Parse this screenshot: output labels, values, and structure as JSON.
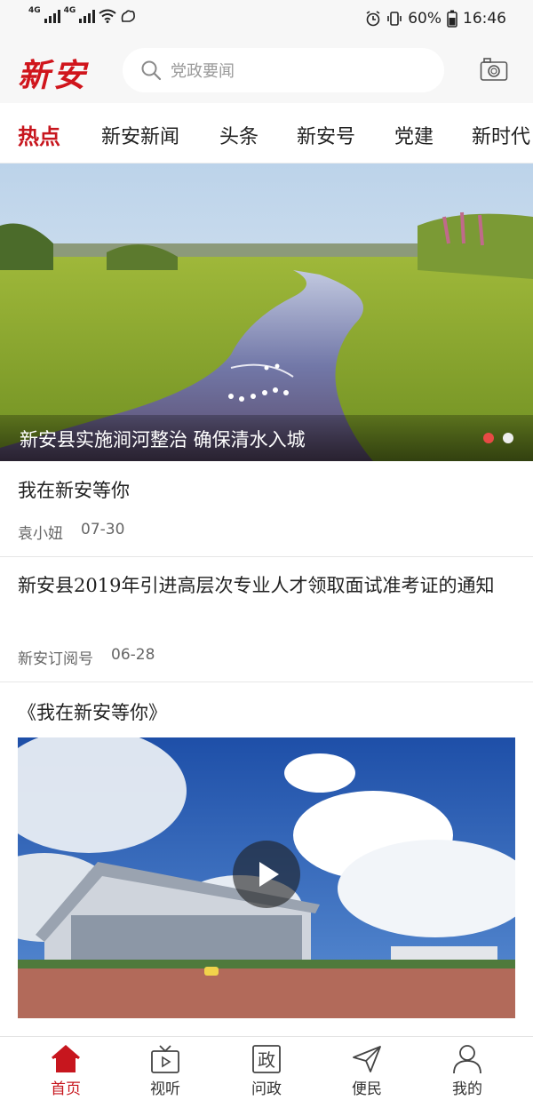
{
  "status_bar": {
    "network_1": "4G",
    "network_2": "4G",
    "battery": "60%",
    "time": "16:46",
    "icons": [
      "signal-icon",
      "wifi-icon",
      "squirrel-icon",
      "alarm-icon",
      "vibrate-icon",
      "battery-icon"
    ]
  },
  "header": {
    "logo_text": "新安",
    "search_placeholder": "党政要闻",
    "brand_color": "#d0151c"
  },
  "tabs": [
    {
      "label": "热点",
      "active": true
    },
    {
      "label": "新安新闻",
      "active": false
    },
    {
      "label": "头条",
      "active": false
    },
    {
      "label": "新安号",
      "active": false
    },
    {
      "label": "党建",
      "active": false
    },
    {
      "label": "新时代",
      "active": false
    }
  ],
  "banner": {
    "title": "新安县实施涧河整治 确保清水入城",
    "slide_count": 2,
    "active_slide": 1
  },
  "articles": [
    {
      "title": "我在新安等你",
      "source": "袁小妞",
      "date": "07-30"
    },
    {
      "title": "新安县2019年引进高层次专业人才领取面试准考证的通知",
      "source": "新安订阅号",
      "date": "06-28"
    }
  ],
  "video_card": {
    "title": "《我在新安等你》"
  },
  "bottom_nav": [
    {
      "label": "首页",
      "icon": "home-icon",
      "active": true
    },
    {
      "label": "视听",
      "icon": "tv-icon",
      "active": false
    },
    {
      "label": "问政",
      "icon": "zheng-icon",
      "glyph": "政",
      "active": false
    },
    {
      "label": "便民",
      "icon": "send-icon",
      "active": false
    },
    {
      "label": "我的",
      "icon": "user-icon",
      "active": false
    }
  ],
  "colors": {
    "accent": "#c7161e",
    "dot_active": "#e84a45"
  }
}
